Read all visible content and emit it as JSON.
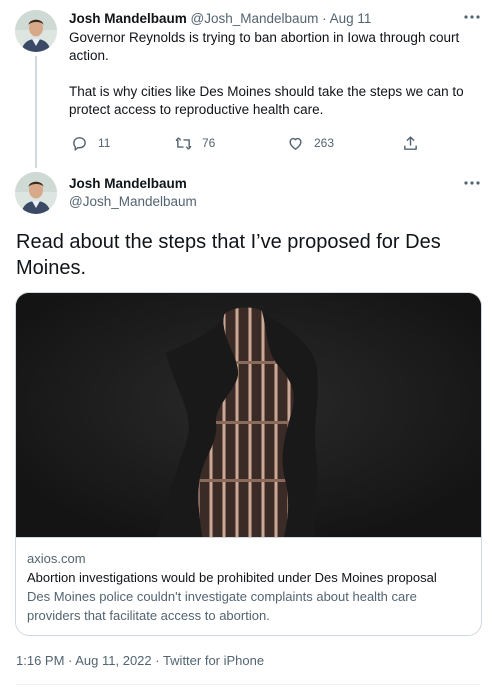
{
  "tweet1": {
    "name": "Josh Mandelbaum",
    "handle": "@Josh_Mandelbaum",
    "separator": "·",
    "date": "Aug 11",
    "text_p1": "Governor Reynolds is trying to ban abortion in Iowa through court action.",
    "text_p2": "That is why cities like Des Moines should take the steps we can to protect access to reproductive health care.",
    "replies": "11",
    "retweets": "76",
    "likes": "263",
    "more_icon": "more-icon",
    "icons": [
      "reply-icon",
      "retweet-icon",
      "like-icon",
      "share-icon"
    ]
  },
  "tweet2": {
    "name": "Josh Mandelbaum",
    "handle": "@Josh_Mandelbaum",
    "text": "Read about the steps that I’ve proposed for Des Moines.",
    "card": {
      "domain": "axios.com",
      "title": "Abortion investigations would be prohibited under Des Moines proposal",
      "description": "Des Moines police couldn't investigate complaints about health care providers that facilitate access to abortion."
    },
    "timestamp": "1:16 PM · Aug 11, 2022 · Twitter for iPhone"
  },
  "colors": {
    "primary_text": "#0f1419",
    "secondary_text": "#536471",
    "border": "#cfd9de"
  }
}
